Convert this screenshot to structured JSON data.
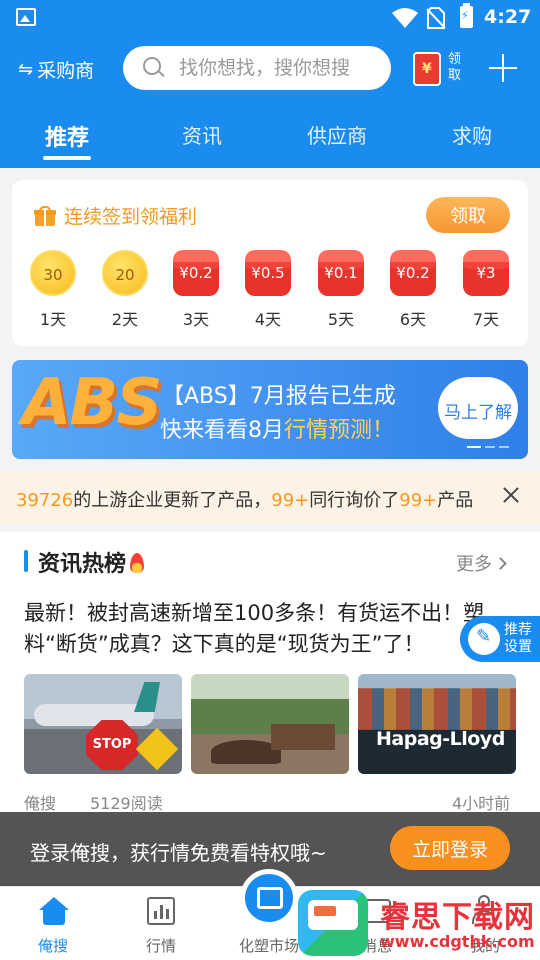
{
  "status_bar": {
    "time": "4:27"
  },
  "header": {
    "role_switch_label": "采购商",
    "search_placeholder": "找你想找，搜你想搜",
    "claim_label": "领取",
    "tabs": [
      {
        "label": "推荐",
        "active": true
      },
      {
        "label": "资讯",
        "active": false
      },
      {
        "label": "供应商",
        "active": false
      },
      {
        "label": "求购",
        "active": false
      }
    ]
  },
  "checkin": {
    "title": "连续签到领福利",
    "claim_button": "领取",
    "days": [
      {
        "reward": "30",
        "label": "1天",
        "kind": "coin"
      },
      {
        "reward": "20",
        "label": "2天",
        "kind": "coin"
      },
      {
        "reward": "¥0.2",
        "label": "3天",
        "kind": "red-envelope"
      },
      {
        "reward": "¥0.5",
        "label": "4天",
        "kind": "red-envelope"
      },
      {
        "reward": "¥0.1",
        "label": "5天",
        "kind": "red-envelope"
      },
      {
        "reward": "¥0.2",
        "label": "6天",
        "kind": "red-envelope"
      },
      {
        "reward": "¥3",
        "label": "7天",
        "kind": "red-envelope"
      }
    ]
  },
  "banner": {
    "logo_text": "ABS",
    "line1": "【ABS】7月报告已生成",
    "line2_prefix": "快来看看8月",
    "line2_highlight": "行情预测！",
    "button": "马上了解"
  },
  "ticker": {
    "num1": "39726",
    "text1": "的上游企业更新了产品，",
    "num2": "99+",
    "text2": "同行询价了",
    "num3": "99+",
    "text3": "产品"
  },
  "hot_news": {
    "title": "资讯热榜",
    "more": "更多",
    "article": {
      "headline": "最新！被封高速新增至100多条！有货运不出！塑料“断货”成真？这下真的是“现货为王”了！",
      "image2_text": "STOP",
      "image3_text": "Hapag-Lloyd",
      "source": "俺搜",
      "reads": "5129阅读",
      "time": "4小时前"
    }
  },
  "recommend_float": {
    "label": "推荐设置"
  },
  "login_bar": {
    "message": "登录俺搜，获行情免费看特权哦~",
    "button": "立即登录"
  },
  "bottom_nav": [
    {
      "label": "俺搜",
      "active": true
    },
    {
      "label": "行情",
      "active": false
    },
    {
      "label": "化塑市场",
      "active": false
    },
    {
      "label": "消息",
      "active": false
    },
    {
      "label": "我的",
      "active": false
    }
  ],
  "watermark": {
    "title": "睿思下载网",
    "url": "www.cdgthk.com"
  },
  "colors": {
    "primary": "#1a8cf0",
    "orange": "#f39a1e",
    "red": "#e8332b"
  }
}
